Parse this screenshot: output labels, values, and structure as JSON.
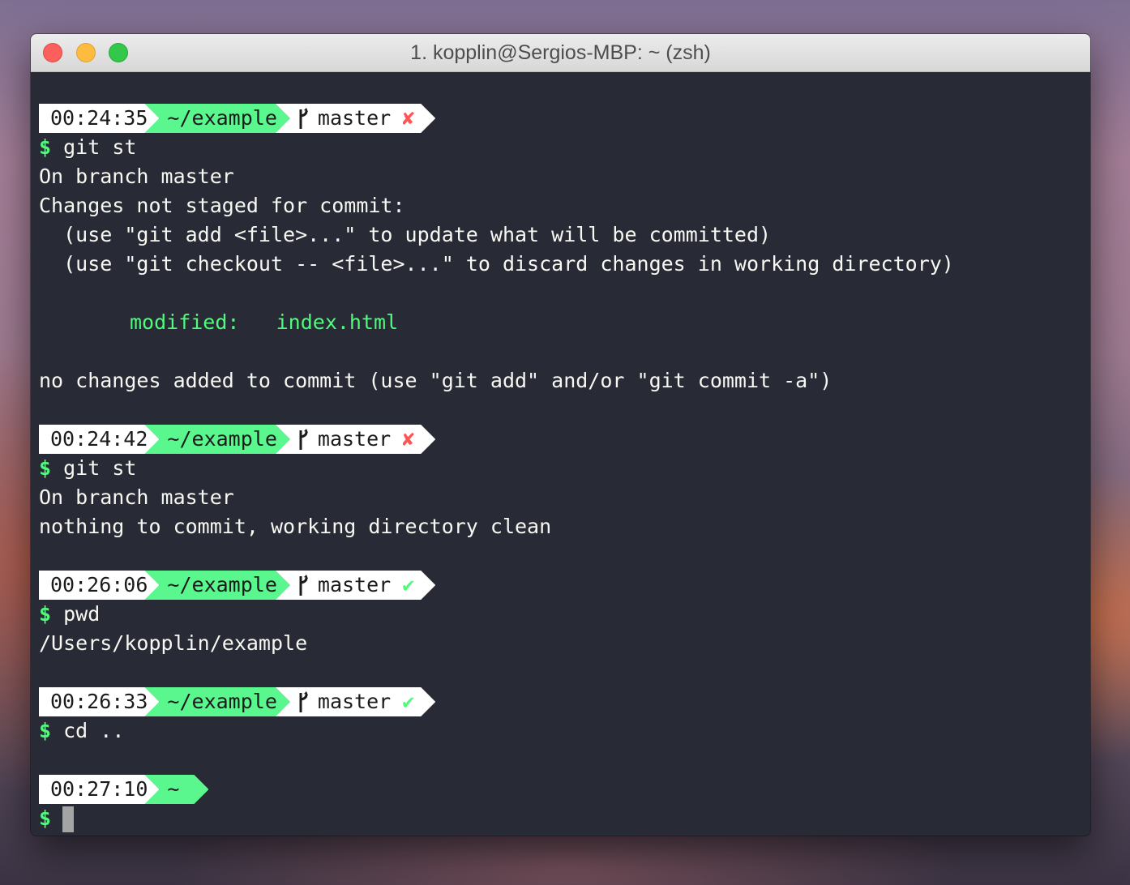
{
  "window": {
    "title": "1. kopplin@Sergios-MBP: ~ (zsh)"
  },
  "colors": {
    "terminal_bg": "#282a36",
    "accent_green": "#50fa7b",
    "error_red": "#ff5555",
    "text": "#f8f8f2"
  },
  "prompts": [
    {
      "time": "00:24:35",
      "dir": "~/example",
      "branch": "master",
      "status": "✘"
    },
    {
      "time": "00:24:42",
      "dir": "~/example",
      "branch": "master",
      "status": "✘"
    },
    {
      "time": "00:26:06",
      "dir": "~/example",
      "branch": "master",
      "status": "✔"
    },
    {
      "time": "00:26:33",
      "dir": "~/example",
      "branch": "master",
      "status": "✔"
    },
    {
      "time": "00:27:10",
      "dir": "~"
    }
  ],
  "prompt_symbol": "$",
  "commands": [
    "git st",
    "git st",
    "pwd",
    "cd .."
  ],
  "output": {
    "block1": {
      "line1": "On branch master",
      "line2": "Changes not staged for commit:",
      "line3": "  (use \"git add <file>...\" to update what will be committed)",
      "line4": "  (use \"git checkout -- <file>...\" to discard changes in working directory)",
      "modified_label": "modified:",
      "modified_file": "index.html",
      "line6": "no changes added to commit (use \"git add\" and/or \"git commit -a\")"
    },
    "block2": {
      "line1": "On branch master",
      "line2": "nothing to commit, working directory clean"
    },
    "block3": {
      "line1": "/Users/kopplin/example"
    }
  }
}
